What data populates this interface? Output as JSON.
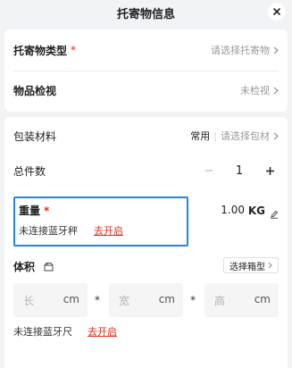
{
  "header": {
    "title": "托寄物信息"
  },
  "item_type": {
    "label": "托寄物类型",
    "required_mark": "*",
    "placeholder": "请选择托寄物"
  },
  "inspection": {
    "label": "物品检视",
    "status": "未检视"
  },
  "packaging": {
    "label": "包装材料",
    "common": "常用",
    "separator": "|",
    "placeholder": "请选择包材"
  },
  "quantity": {
    "label": "总件数",
    "minus": "−",
    "plus": "+",
    "value": "1"
  },
  "weight": {
    "label": "重量",
    "required_mark": "*",
    "value": "1.00",
    "unit": "KG",
    "bluetooth_status": "未连接蓝牙秤",
    "bluetooth_action": "去开启"
  },
  "volume": {
    "label": "体积",
    "select_box_label": "选择箱型",
    "length_placeholder": "长",
    "width_placeholder": "宽",
    "height_placeholder": "高",
    "unit": "cm",
    "times": "*",
    "ruler_status": "未连接蓝牙尺",
    "ruler_action": "去开启"
  },
  "colors": {
    "accent_red": "#e0301e",
    "highlight_blue": "#1e88e5"
  }
}
